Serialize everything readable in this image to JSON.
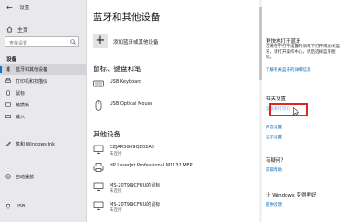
{
  "sidebar": {
    "back_arrow": "←",
    "app_title": "设置",
    "home_label": "主页",
    "search_placeholder": "查找设置",
    "section_label": "设备",
    "items": [
      {
        "label": "蓝牙和其他设备",
        "icon": "bluetooth-icon"
      },
      {
        "label": "打印机和扫描仪",
        "icon": "printer-icon"
      },
      {
        "label": "鼠标",
        "icon": "mouse-icon"
      },
      {
        "label": "触摸板",
        "icon": "touchpad-icon"
      },
      {
        "label": "输入",
        "icon": "keyboard-icon"
      },
      {
        "label": "笔和 Windows Ink",
        "icon": "pen-icon"
      },
      {
        "label": "自动播放",
        "icon": "autoplay-icon"
      },
      {
        "label": "USB",
        "icon": "usb-icon"
      }
    ]
  },
  "main": {
    "title": "蓝牙和其他设备",
    "add_device_label": "添加蓝牙或其他设备",
    "group_input": "鼠标、键盘和笔",
    "input_devices": [
      {
        "name": "USB Keyboard",
        "icon": "keyboard-icon"
      },
      {
        "name": "USB Optical Mouse",
        "icon": "mouse-icon"
      }
    ],
    "group_other": "其他设备",
    "other_devices": [
      {
        "name": "CZJAR3G09QZ02A0",
        "status": "未连接",
        "icon": "monitor-icon"
      },
      {
        "name": "HP LaserJet Professional M1132 MFP",
        "status": "",
        "icon": "printer-icon"
      },
      {
        "name": "MS-20T9I9CFUU的鼠标",
        "status": "未连接",
        "icon": "monitor-icon"
      },
      {
        "name": "MS-20T9I9CFUU的鼠标",
        "status": "未连接",
        "icon": "monitor-icon"
      }
    ]
  },
  "right_panel": {
    "section1_title": "更快地打开蓝牙",
    "section1_text": "若要在不打开设置的情况下打开或关闭蓝牙，请打开操作中心，然后选择蓝牙图标。",
    "section1_link": "了解有关蓝牙的详细信息",
    "section2_title": "相关设置",
    "related_links": [
      "设备和打印机",
      "声音设置",
      "显示设置"
    ],
    "section3_title": "有疑问？",
    "help_link": "获取帮助",
    "section4_title": "让 Windows 变得更好",
    "feedback_link": "提供反馈"
  }
}
